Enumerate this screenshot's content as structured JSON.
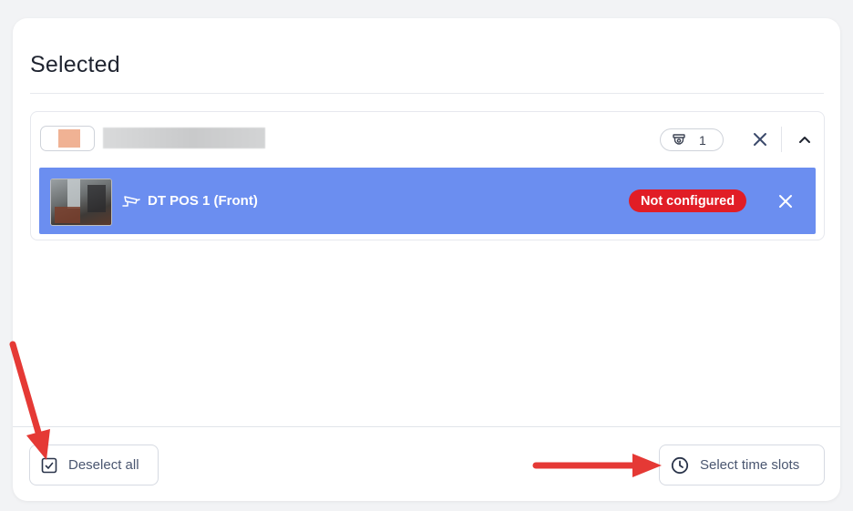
{
  "panel": {
    "title": "Selected"
  },
  "group": {
    "swatch_color": "#f0b294",
    "camera_count": "1",
    "count_icon": "camera-dome-icon",
    "remove_icon": "close-icon",
    "toggle_icon": "chevron-up-icon"
  },
  "camera": {
    "name": "DT POS 1 (Front)",
    "type_icon": "security-camera-icon",
    "status": "Not configured",
    "row_color": "#6b8ef0",
    "status_color": "#e11d26"
  },
  "footer": {
    "deselect_label": "Deselect all",
    "deselect_icon": "checkbox-checked-icon",
    "timeslots_label": "Select time slots",
    "timeslots_icon": "clock-icon"
  },
  "annotations": {
    "arrow_color": "#e53935"
  }
}
